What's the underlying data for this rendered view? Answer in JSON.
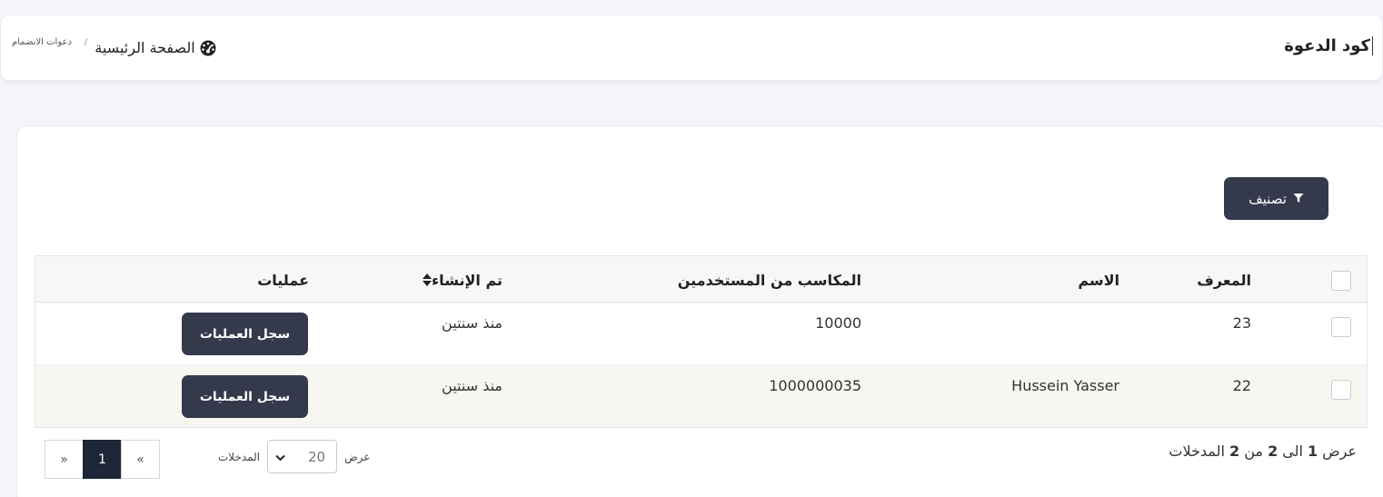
{
  "header": {
    "title": "كود الدعوة",
    "breadcrumb": {
      "home": "الصفحة الرئيسية",
      "separator": "/",
      "current": "دعوات الانضمام"
    }
  },
  "toolbar": {
    "filter_label": "تصنيف"
  },
  "table": {
    "columns": {
      "id": "المعرف",
      "name": "الاسم",
      "earnings": "المكاسب من المستخدمين",
      "created": "تم الإنشاء",
      "operations": "عمليات"
    },
    "rows": [
      {
        "id": "23",
        "name": "",
        "earnings": "10000",
        "created": "منذ سنتين",
        "action": "سجل العمليات"
      },
      {
        "id": "22",
        "name": "Hussein Yasser",
        "earnings": "1000000035",
        "created": "منذ سنتين",
        "action": "سجل العمليات"
      }
    ]
  },
  "footer": {
    "info": {
      "prefix": "عرض",
      "from": "1",
      "to_word": "الى",
      "to": "2",
      "of_word": "من",
      "total": "2",
      "suffix": "المدخلات"
    },
    "length": {
      "show": "عرض",
      "value": "20",
      "entries": "المدخلات"
    },
    "pagination": {
      "prev": "«",
      "current": "1",
      "next": "»"
    }
  },
  "colors": {
    "button_dark": "#343a4b",
    "pagination_active": "#1e2737",
    "row_alt": "#f7f6f1",
    "page_bg": "#f4f5f8"
  },
  "icons": {
    "home": "dashboard-gauge-icon",
    "filter": "funnel-icon",
    "sort": "sort-arrows-icon",
    "select": "chevron-down-icon"
  }
}
